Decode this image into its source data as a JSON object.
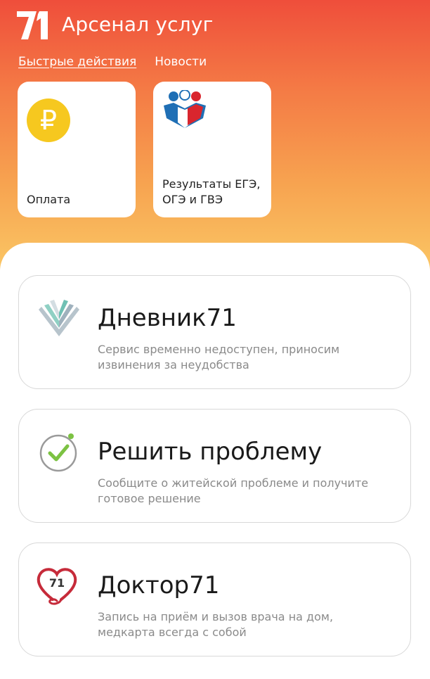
{
  "app": {
    "title": "Арсенал услуг",
    "logo_icon": "logo-71-icon"
  },
  "tabs": [
    {
      "label": "Быстрые действия",
      "active": true
    },
    {
      "label": "Новости",
      "active": false
    }
  ],
  "quick_actions": [
    {
      "label": "Оплата",
      "icon": "ruble-icon",
      "icon_glyph": "₽"
    },
    {
      "label": "Результаты ЕГЭ, ОГЭ и ГВЭ",
      "icon": "exam-results-icon"
    }
  ],
  "services": [
    {
      "title": "Дневник71",
      "description": "Сервис временно недоступен, приносим извинения за неудобства",
      "icon": "open-book-icon"
    },
    {
      "title": "Решить проблему",
      "description": "Сообщите о житейской проблеме и получите готовое решение",
      "icon": "check-circle-icon"
    },
    {
      "title": "Доктор71",
      "description": "Запись на приём и вызов врача на дом, медкарта всегда с собой",
      "icon": "heart-71-icon",
      "icon_text": "71"
    }
  ],
  "colors": {
    "header_gradient_top": "#ef4e3b",
    "header_gradient_bottom": "#fbd06a",
    "ruble_yellow": "#f6c81f",
    "check_green": "#7cc242",
    "heart_red": "#c62b3a"
  }
}
